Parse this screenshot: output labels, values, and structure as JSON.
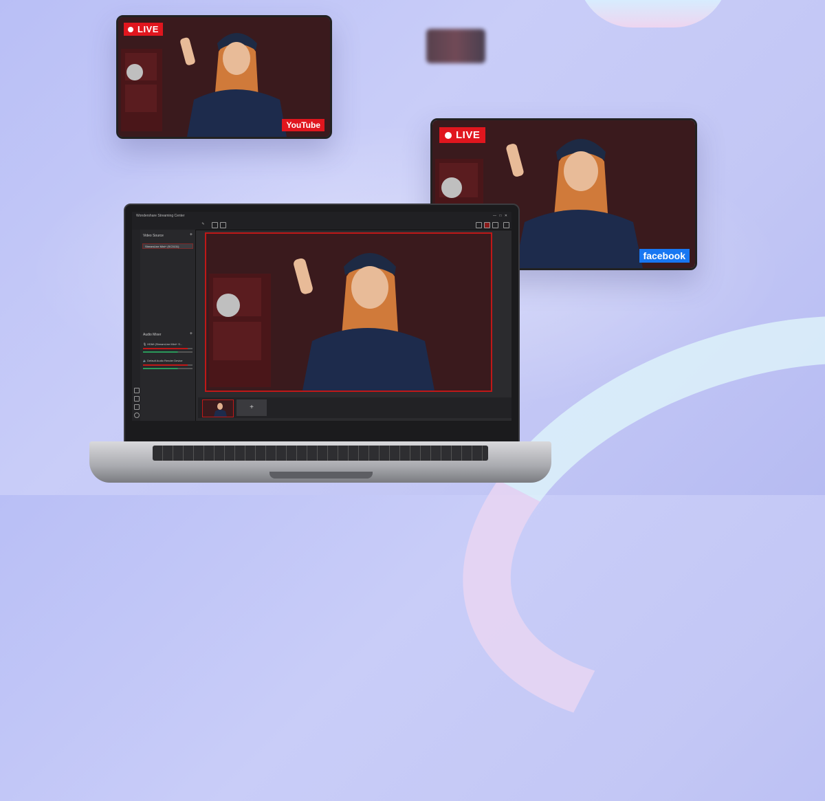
{
  "cards": {
    "youtube": {
      "live_label": "LIVE",
      "platform_label": "YouTube",
      "platform_color": "#e0161e"
    },
    "facebook": {
      "live_label": "LIVE",
      "platform_label": "facebook",
      "platform_color": "#1877f2"
    }
  },
  "app": {
    "title": "Wondershare Streaming Center",
    "window_controls": [
      "—",
      "□",
      "✕"
    ],
    "video_source": {
      "title": "Video Source",
      "items": [
        "StreamLine Mini+ (SC3131)"
      ]
    },
    "audio_mixer": {
      "title": "Audio Mixer",
      "items": [
        "HDMI (StreamLine Mini+ S...",
        "Default Audio Render Device"
      ]
    },
    "add_scene_label": "+"
  },
  "colors": {
    "accent": "#c01818",
    "live_red": "#e0161e",
    "facebook_blue": "#1877f2"
  }
}
